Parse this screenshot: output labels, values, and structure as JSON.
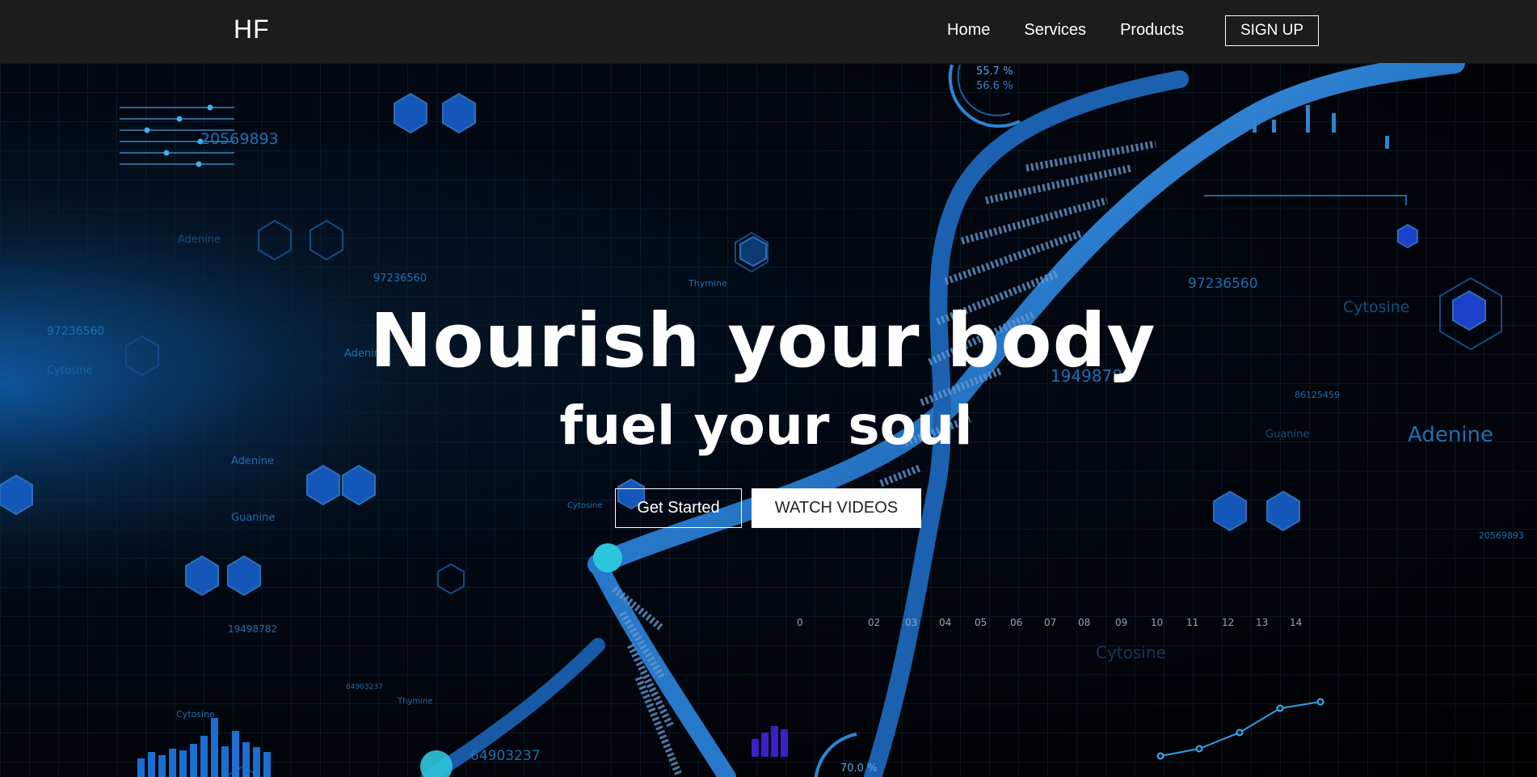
{
  "brand": {
    "logo": "HF"
  },
  "nav": {
    "items": [
      {
        "label": "Home"
      },
      {
        "label": "Services"
      },
      {
        "label": "Products"
      }
    ],
    "signup_label": "SIGN UP"
  },
  "hero": {
    "title": "Nourish your body",
    "subtitle": "fuel your soul",
    "primary_button": "Get Started",
    "secondary_button": "WATCH VIDEOS"
  },
  "background_decor": {
    "numbers": [
      "20569893",
      "97236560",
      "97236560",
      "97236560",
      "19498782",
      "19498782",
      "64903237",
      "86125459",
      "20569893",
      "64903237"
    ],
    "words": [
      "Adenine",
      "Adenine",
      "Adenine",
      "Adenine",
      "Cytosine",
      "Cytosine",
      "Cytosine",
      "Cytosine",
      "Thymine",
      "Thymine",
      "Guanine",
      "Guanine",
      "Cytosine"
    ],
    "gauge_top": [
      "55.7 %",
      "56.6 %"
    ],
    "gauge_bottom": "70.0 %",
    "scale_ticks": [
      "0",
      "02",
      "03",
      "04",
      "05",
      "06",
      "07",
      "08",
      "09",
      "10",
      "11",
      "12",
      "13",
      "14"
    ],
    "colors": {
      "accent_blue": "#1f6fb0",
      "hex_blue": "#1557b8",
      "dna_blue": "#2a7fd4"
    }
  }
}
